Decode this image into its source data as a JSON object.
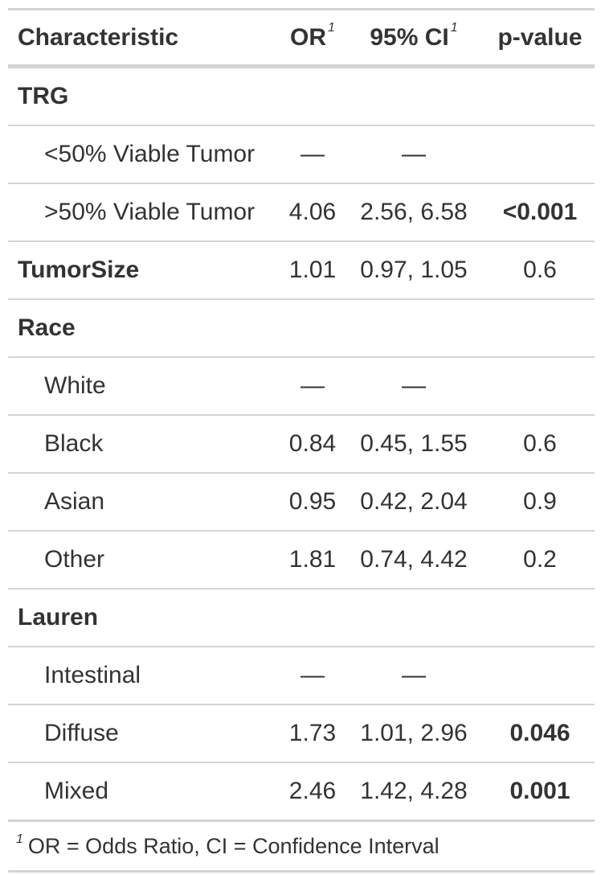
{
  "header": {
    "characteristic": "Characteristic",
    "or": "OR",
    "or_mark": "1",
    "ci": "95% CI",
    "ci_mark": "1",
    "p": "p-value"
  },
  "rows": [
    {
      "label": "TRG",
      "type": "variable",
      "or": "",
      "ci": "",
      "p": "",
      "p_bold": false
    },
    {
      "label": "<50% Viable Tumor",
      "type": "level",
      "or": "—",
      "ci": "—",
      "p": "",
      "p_bold": false
    },
    {
      "label": ">50% Viable Tumor",
      "type": "level",
      "or": "4.06",
      "ci": "2.56, 6.58",
      "p": "<0.001",
      "p_bold": true
    },
    {
      "label": "TumorSize",
      "type": "variable",
      "or": "1.01",
      "ci": "0.97, 1.05",
      "p": "0.6",
      "p_bold": false
    },
    {
      "label": "Race",
      "type": "variable",
      "or": "",
      "ci": "",
      "p": "",
      "p_bold": false
    },
    {
      "label": "White",
      "type": "level",
      "or": "—",
      "ci": "—",
      "p": "",
      "p_bold": false
    },
    {
      "label": "Black",
      "type": "level",
      "or": "0.84",
      "ci": "0.45, 1.55",
      "p": "0.6",
      "p_bold": false
    },
    {
      "label": "Asian",
      "type": "level",
      "or": "0.95",
      "ci": "0.42, 2.04",
      "p": "0.9",
      "p_bold": false
    },
    {
      "label": "Other",
      "type": "level",
      "or": "1.81",
      "ci": "0.74, 4.42",
      "p": "0.2",
      "p_bold": false
    },
    {
      "label": "Lauren",
      "type": "variable",
      "or": "",
      "ci": "",
      "p": "",
      "p_bold": false
    },
    {
      "label": "Intestinal",
      "type": "level",
      "or": "—",
      "ci": "—",
      "p": "",
      "p_bold": false
    },
    {
      "label": "Diffuse",
      "type": "level",
      "or": "1.73",
      "ci": "1.01, 2.96",
      "p": "0.046",
      "p_bold": true
    },
    {
      "label": "Mixed",
      "type": "level",
      "or": "2.46",
      "ci": "1.42, 4.28",
      "p": "0.001",
      "p_bold": true
    }
  ],
  "footnote": {
    "mark": "1",
    "text": "OR = Odds Ratio, CI = Confidence Interval"
  }
}
